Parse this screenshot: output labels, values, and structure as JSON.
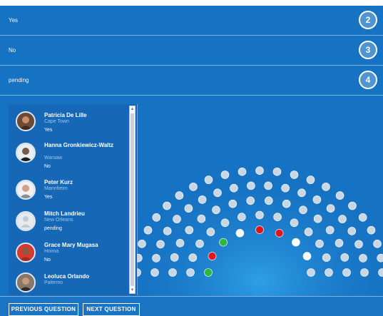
{
  "options": [
    {
      "label": "Yes",
      "number": "2"
    },
    {
      "label": "No",
      "number": "3"
    },
    {
      "label": "pending",
      "number": "4"
    }
  ],
  "voters": [
    {
      "name": "Patricia De Lille",
      "city": "Cape Town",
      "vote": "Yes",
      "avatar_icon": "person-photo-icon"
    },
    {
      "name": "Hanna Gronkiewicz-Waltz",
      "city": "Warsaw",
      "vote": "No",
      "avatar_icon": "person-photo-icon"
    },
    {
      "name": "Peter Kurz",
      "city": "Mannheim",
      "vote": "Yes",
      "avatar_icon": "person-photo-icon"
    },
    {
      "name": "Mitch Landrieu",
      "city": "New Orleans",
      "vote": "pending",
      "avatar_icon": "default-avatar-icon"
    },
    {
      "name": "Grace Mary Mugasa",
      "city": "Hoima",
      "vote": "No",
      "avatar_icon": "person-photo-icon"
    },
    {
      "name": "Leoluca Orlando",
      "city": "Palermo",
      "vote": "",
      "avatar_icon": "person-photo-icon"
    }
  ],
  "buttons": {
    "previous": "PREVIOUS QUESTION",
    "next": "NEXT QUESTION"
  },
  "seat_colors": {
    "yes": "#2db83d",
    "no": "#e0161e",
    "pending": "#ffffff",
    "empty": "#c8d6e6"
  },
  "hemicycle": {
    "yes_seats": 2,
    "no_seats": 3,
    "pending_seats": 3
  }
}
